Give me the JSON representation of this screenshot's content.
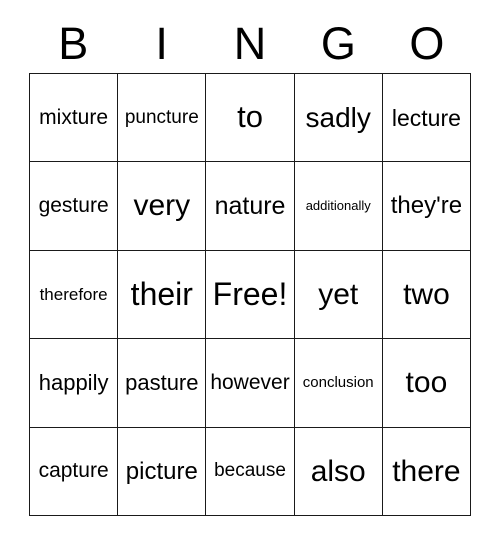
{
  "card": {
    "title": "BINGO",
    "header_letters": [
      "B",
      "I",
      "N",
      "G",
      "O"
    ],
    "free_space": "Free!",
    "colors": {
      "background": "#ffffff",
      "border": "#1a1a1a",
      "text": "#000000"
    },
    "rows": [
      [
        {
          "text": "mixture",
          "size": 21
        },
        {
          "text": "puncture",
          "size": 19
        },
        {
          "text": "to",
          "size": 31
        },
        {
          "text": "sadly",
          "size": 28
        },
        {
          "text": "lecture",
          "size": 23
        }
      ],
      [
        {
          "text": "gesture",
          "size": 21
        },
        {
          "text": "very",
          "size": 30
        },
        {
          "text": "nature",
          "size": 25
        },
        {
          "text": "additionally",
          "size": 13
        },
        {
          "text": "they're",
          "size": 24
        }
      ],
      [
        {
          "text": "therefore",
          "size": 17
        },
        {
          "text": "their",
          "size": 32
        },
        {
          "text": "Free!",
          "size": 32
        },
        {
          "text": "yet",
          "size": 30
        },
        {
          "text": "two",
          "size": 30
        }
      ],
      [
        {
          "text": "happily",
          "size": 22
        },
        {
          "text": "pasture",
          "size": 22
        },
        {
          "text": "however",
          "size": 21
        },
        {
          "text": "conclusion",
          "size": 15
        },
        {
          "text": "too",
          "size": 30
        }
      ],
      [
        {
          "text": "capture",
          "size": 21
        },
        {
          "text": "picture",
          "size": 24
        },
        {
          "text": "because",
          "size": 19
        },
        {
          "text": "also",
          "size": 30
        },
        {
          "text": "there",
          "size": 30
        }
      ]
    ]
  }
}
